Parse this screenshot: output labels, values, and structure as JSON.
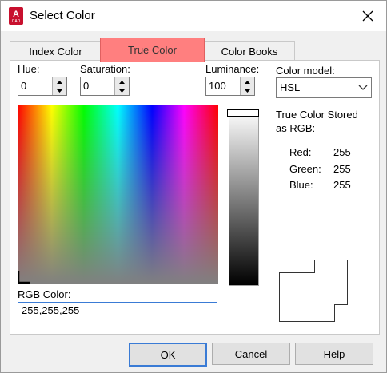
{
  "window": {
    "title": "Select Color",
    "app_icon_text": "A",
    "app_icon_subtext": "CAD"
  },
  "tabs": [
    {
      "label": "Index Color",
      "active": false
    },
    {
      "label": "True Color",
      "active": true
    },
    {
      "label": "Color Books",
      "active": false
    }
  ],
  "hue": {
    "label": "Hue:",
    "value": "0"
  },
  "saturation": {
    "label": "Saturation:",
    "value": "0"
  },
  "luminance": {
    "label": "Luminance:",
    "value": "100"
  },
  "color_model": {
    "label": "Color model:",
    "value": "HSL"
  },
  "stored": {
    "heading_line1": "True Color Stored",
    "heading_line2": "as RGB:",
    "rows": [
      {
        "label": "Red:",
        "value": "255"
      },
      {
        "label": "Green:",
        "value": "255"
      },
      {
        "label": "Blue:",
        "value": "255"
      }
    ]
  },
  "rgb_color": {
    "label": "RGB Color:",
    "value": "255,255,255"
  },
  "buttons": {
    "ok": "OK",
    "cancel": "Cancel",
    "help": "Help"
  },
  "colors": {
    "active_tab": "#ff7f7f",
    "focus_border": "#3a7bd5",
    "current_color": "#ffffff"
  }
}
